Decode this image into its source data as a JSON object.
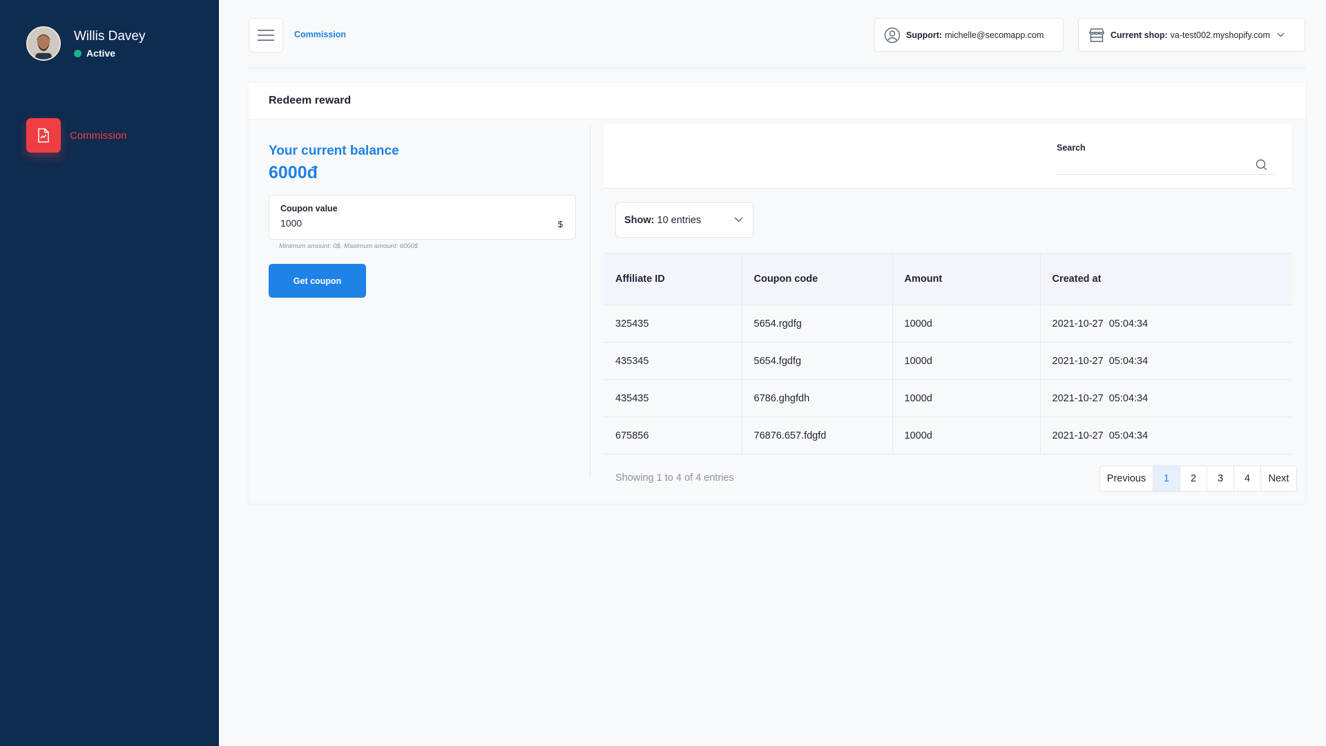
{
  "sidebar": {
    "user": {
      "name": "Willis Davey",
      "status": "Active",
      "status_color": "#19b38a"
    },
    "nav": [
      {
        "label": "Commission",
        "icon": "document-chart-icon",
        "active": true
      }
    ]
  },
  "header": {
    "breadcrumb": "Commission",
    "support": {
      "label": "Support:",
      "value": "michelle@secomapp.com"
    },
    "shop": {
      "label": "Current shop:",
      "value": "va-test002.myshopify.com"
    }
  },
  "card": {
    "title": "Redeem reward",
    "balance": {
      "title": "Your current balance",
      "value": "6000đ"
    },
    "coupon": {
      "label": "Coupon value",
      "value": "1000",
      "unit": "$",
      "hint": "Minimum amount: 0$. Maximum amount: 6000$",
      "button": "Get coupon"
    }
  },
  "table_panel": {
    "search_label": "Search",
    "search_placeholder": "",
    "show": {
      "label": "Show:",
      "value": "10 entries"
    },
    "columns": [
      "Affiliate ID",
      "Coupon code",
      "Amount",
      "Created at"
    ],
    "rows": [
      {
        "id": "325435",
        "code": "5654.rgdfg",
        "amount": "1000d",
        "created": "2021-10-27  05:04:34"
      },
      {
        "id": "435345",
        "code": "5654.fgdfg",
        "amount": "1000d",
        "created": "2021-10-27  05:04:34"
      },
      {
        "id": "435435",
        "code": "6786.ghgfdh",
        "amount": "1000d",
        "created": "2021-10-27  05:04:34"
      },
      {
        "id": "675856",
        "code": "76876.657.fdgfd",
        "amount": "1000d",
        "created": "2021-10-27  05:04:34"
      }
    ],
    "showing": "Showing 1 to 4 of 4 entries",
    "pagination": {
      "previous": "Previous",
      "pages": [
        "1",
        "2",
        "3",
        "4"
      ],
      "next": "Next",
      "current": "1"
    }
  },
  "colors": {
    "sidebar_bg": "#0e2b50",
    "accent": "#1e82e6",
    "danger": "#ef3e43"
  }
}
